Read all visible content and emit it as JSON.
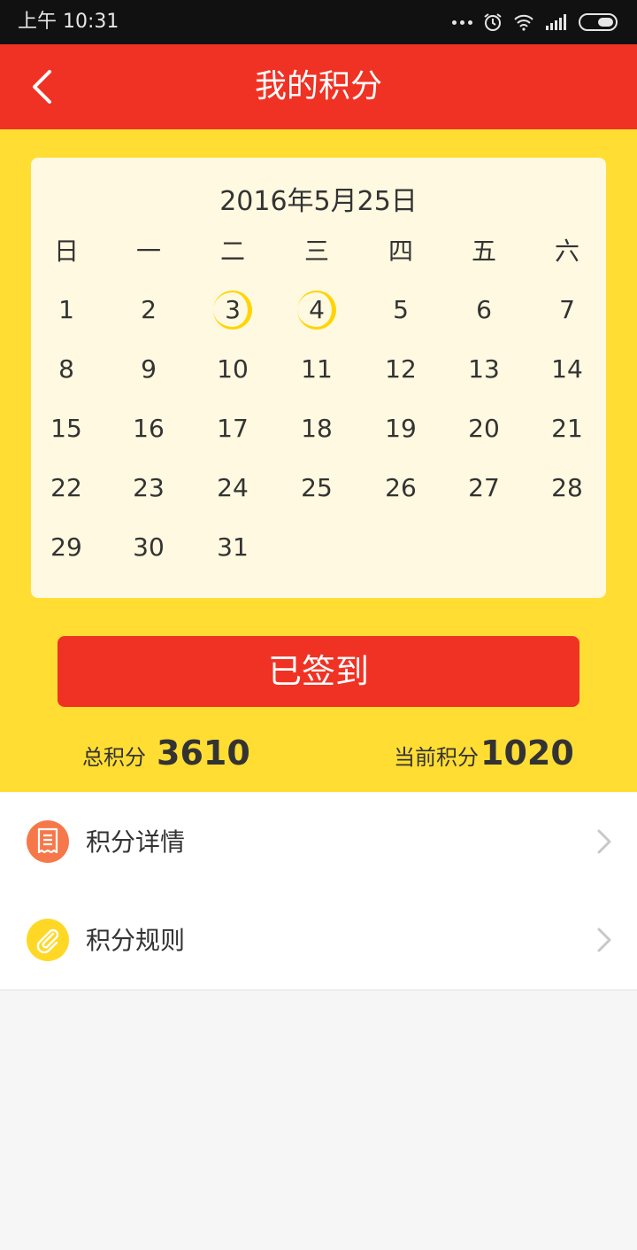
{
  "status": {
    "time": "上午 10:31"
  },
  "header": {
    "title": "我的积分",
    "back_icon": "chevron-left-icon"
  },
  "calendar": {
    "date": "2016年5月25日",
    "weekdays": [
      "日",
      "一",
      "二",
      "三",
      "四",
      "五",
      "六"
    ],
    "weeks": [
      [
        "1",
        "2",
        "3",
        "4",
        "5",
        "6",
        "7"
      ],
      [
        "8",
        "9",
        "10",
        "11",
        "12",
        "13",
        "14"
      ],
      [
        "15",
        "16",
        "17",
        "18",
        "19",
        "20",
        "21"
      ],
      [
        "22",
        "23",
        "24",
        "25",
        "26",
        "27",
        "28"
      ],
      [
        "29",
        "30",
        "31",
        "",
        "",
        "",
        ""
      ]
    ],
    "signed_days": [
      "3",
      "4"
    ],
    "ring_color": "#ffd400"
  },
  "signin": {
    "label": "已签到"
  },
  "points": {
    "total_label": "总积分",
    "total_value": "3610",
    "current_label": "当前积分",
    "current_value": "1020"
  },
  "menu": [
    {
      "label": "积分详情",
      "icon": "receipt-icon",
      "color": "#f6784a"
    },
    {
      "label": "积分规则",
      "icon": "paperclip-icon",
      "color": "#ffd826"
    }
  ],
  "colors": {
    "brand_red": "#f03224",
    "yellow": "#ffdd33",
    "calendar_bg": "#fef9e0"
  }
}
